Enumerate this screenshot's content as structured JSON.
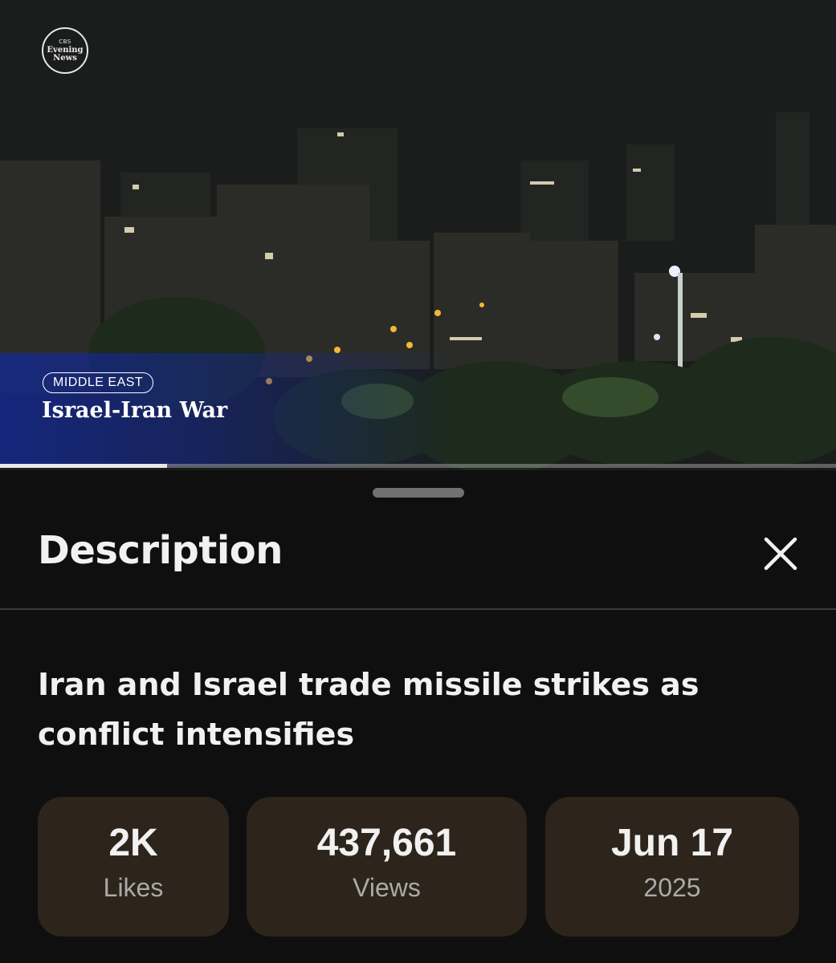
{
  "video": {
    "logo": {
      "network": "CBS",
      "line1": "Evening",
      "line2": "News"
    },
    "section_tag": "MIDDLE EAST",
    "story_title": "Israel-Iran War",
    "progress": 0.2
  },
  "sheet": {
    "title": "Description",
    "close_icon": "close-icon",
    "video_title": "Iran and Israel trade missile strikes as conflict intensifies",
    "stats": {
      "likes": {
        "value": "2K",
        "label": "Likes"
      },
      "views": {
        "value": "437,661",
        "label": "Views"
      },
      "date": {
        "value": "Jun 17",
        "label": "2025"
      }
    }
  },
  "colors": {
    "background": "#0f0f0f",
    "stat_card": "#2d241b",
    "lower_third": "#1428a0"
  }
}
